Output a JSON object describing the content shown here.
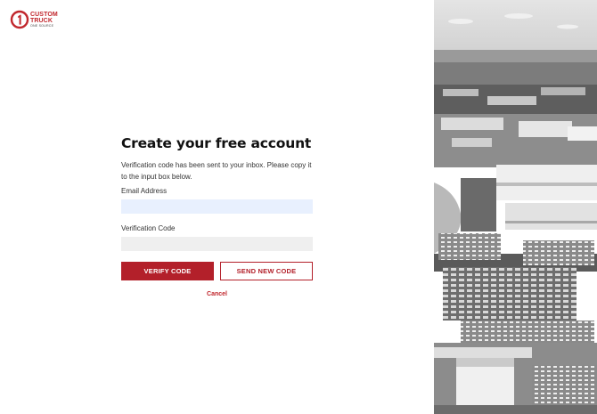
{
  "brand": {
    "line1": "CUSTOM",
    "line2": "TRUCK",
    "line3": "ONE SOURCE",
    "accent_color": "#b3202a"
  },
  "form": {
    "title": "Create your free account",
    "message": "Verification code has been sent to your inbox. Please copy it to the input box below.",
    "email_label": "Email Address",
    "email_value": "",
    "code_label": "Verification Code",
    "code_value": "",
    "verify_button": "VERIFY CODE",
    "resend_button": "SEND NEW CODE",
    "cancel_link": "Cancel"
  },
  "side_image": {
    "subject": "aerial-photo-truck-yard",
    "tone": "grayscale"
  }
}
